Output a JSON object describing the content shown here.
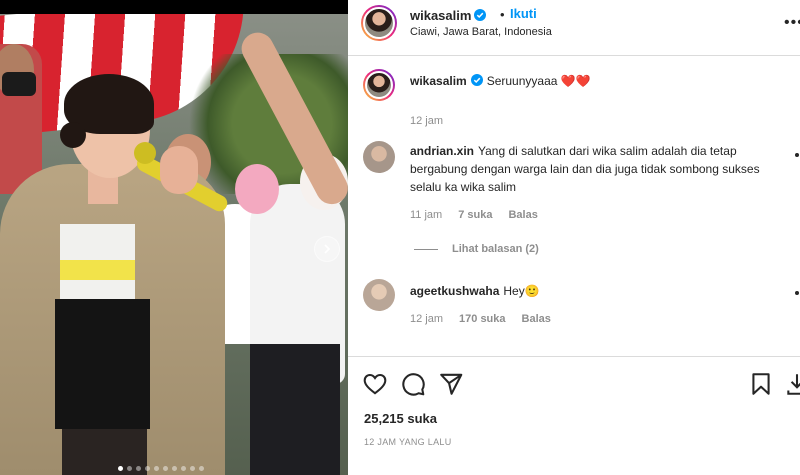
{
  "post": {
    "carousel": {
      "slide_count": 10,
      "active_index": 0
    }
  },
  "header": {
    "username": "wikasalim",
    "separator": "•",
    "follow_label": "Ikuti",
    "location": "Ciawi, Jawa Barat, Indonesia",
    "more_label": "•••"
  },
  "caption": {
    "username": "wikasalim",
    "text": "Seruunyyaaa ❤️❤️",
    "time": "12 jam"
  },
  "comments": [
    {
      "username": "andrian.xin",
      "text": "Yang di salutkan dari wika salim adalah dia tetap bergabung dengan warga lain dan dia juga tidak sombong sukses selalu ka wika salim",
      "time": "11 jam",
      "likes": "7 suka",
      "reply_label": "Balas",
      "view_replies": "Lihat balasan (2)"
    },
    {
      "username": "ageetkushwaha",
      "text": "Hey🙂",
      "time": "12 jam",
      "likes": "170 suka",
      "reply_label": "Balas"
    }
  ],
  "footer": {
    "likes": "25,215 suka",
    "time_ago": "12 JAM YANG LALU"
  },
  "icons": {
    "like": "heart-icon",
    "comment": "comment-bubble-icon",
    "share": "paper-plane-icon",
    "save": "bookmark-icon",
    "next": "chevron-right-icon",
    "verified": "verified-badge-icon"
  },
  "colors": {
    "accent": "#0095f6",
    "text": "#262626",
    "muted": "#8e8e8e",
    "divider": "#dbdbdb"
  }
}
